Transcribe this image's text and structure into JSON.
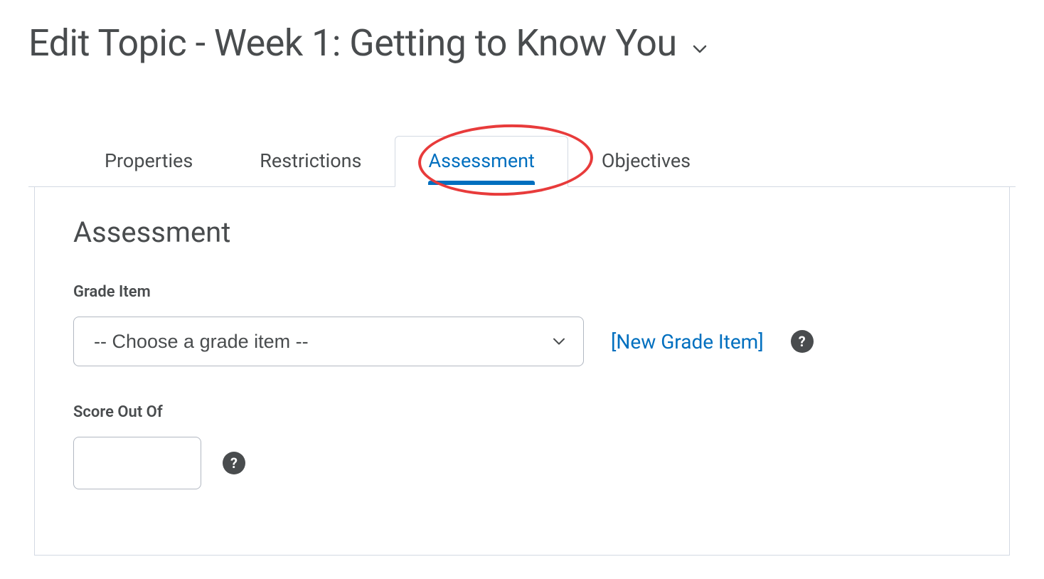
{
  "header": {
    "title": "Edit Topic - Week 1: Getting to Know You"
  },
  "tabs": {
    "items": [
      {
        "label": "Properties",
        "active": false
      },
      {
        "label": "Restrictions",
        "active": false
      },
      {
        "label": "Assessment",
        "active": true
      },
      {
        "label": "Objectives",
        "active": false
      }
    ]
  },
  "panel": {
    "heading": "Assessment",
    "grade_item": {
      "label": "Grade Item",
      "selected": "-- Choose a grade item --",
      "new_link": "[New Grade Item]"
    },
    "score": {
      "label": "Score Out Of",
      "value": ""
    }
  },
  "colors": {
    "link": "#006fbf",
    "text": "#494c4e",
    "border": "#d3d9e3",
    "annotation": "#e83b3b"
  }
}
